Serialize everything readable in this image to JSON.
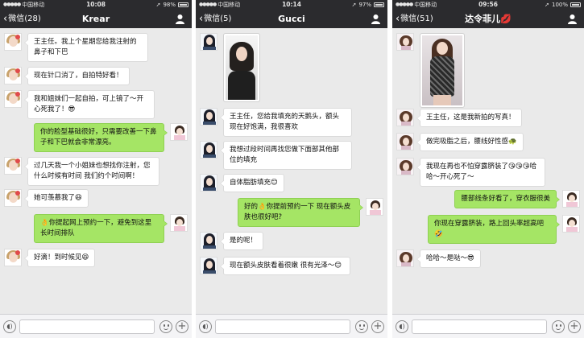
{
  "status": {
    "carrier": "中国移动",
    "wifi_icon": "wifi-icon",
    "battery_icon": "battery-icon"
  },
  "screens": [
    {
      "time": "10:08",
      "battery": "98%",
      "back_label": "微信(28)",
      "title": "Krear",
      "messages": [
        "王主任。我上个星期您给我注射的鼻子和下巴",
        "现在针口消了，自拍特好看！",
        "我和姐妹们一起自拍，可上镜了～开心死我了！😎",
        "你的脸型基础很好，只需要改善一下鼻子和下巴就会非常漂亮。",
        "过几天我一个小姐妹也想找你注射，您什么时候有时间 我们约个时间啊！",
        "她可羡慕我了😆",
        "👌你提起网上预约一下，避免到这里长时间排队",
        "好滴！到时候见😆"
      ]
    },
    {
      "time": "10:14",
      "battery": "97%",
      "back_label": "微信(5)",
      "title": "Gucci",
      "messages": [
        "王主任，您给我填充的天鹅头，额头现在好饱满，我很喜欢",
        "我想过段时间再找您做下面部其他部位的填充",
        "自体脂肪填充😊",
        "好的👌你提前预约一下 现在额头皮肤也很好吧?",
        "是的呢！",
        "现在额头皮肤看着很嫩 很有光泽～😊"
      ]
    },
    {
      "time": "09:56",
      "battery": "100%",
      "back_label": "微信(51)",
      "title": "达令菲儿💋",
      "messages": [
        "王主任，这是我新拍的写真！",
        "做完吸脂之后，腰线好性感🐢",
        "我现在再也不怕穿露脐装了😘😘😘哈哈～开心死了～",
        "腰部线条好看了，穿衣服很美",
        "你现在穿露脐装，路上回头率超高吧🤣",
        "哈哈～是哒～😎"
      ]
    }
  ],
  "input_bar": {
    "voice_icon": "voice-icon",
    "emoji_icon": "emoji-icon",
    "plus_icon": "plus-icon",
    "text_value": ""
  },
  "colors": {
    "header": "#2b2b2e",
    "chat_background": "#eaeaea",
    "sent_bubble": "#a5e565",
    "received_bubble": "#ffffff"
  }
}
